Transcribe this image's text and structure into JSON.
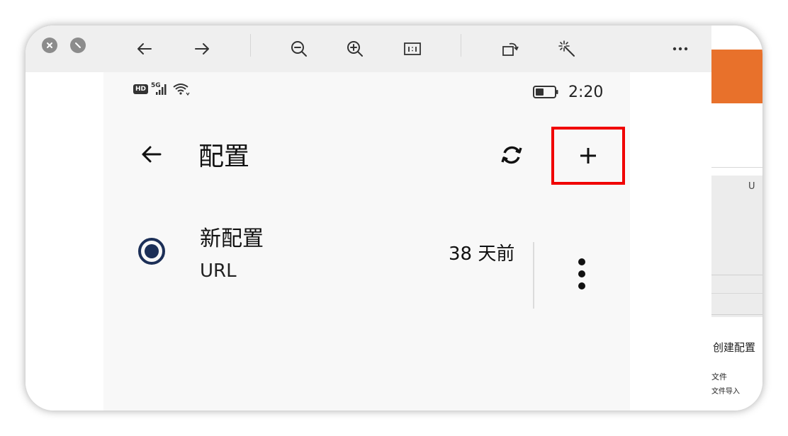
{
  "viewer_toolbar": {
    "close_label": "close",
    "minimize_label": "minimize",
    "items": [
      {
        "icon": "arrow-left-icon"
      },
      {
        "icon": "arrow-right-icon"
      },
      {
        "icon": "zoom-out-icon"
      },
      {
        "icon": "zoom-in-icon"
      },
      {
        "icon": "actual-size-icon"
      },
      {
        "icon": "rotate-icon"
      },
      {
        "icon": "magic-wand-icon"
      },
      {
        "icon": "more-horizontal-icon"
      }
    ]
  },
  "status_bar": {
    "hd": "HD",
    "network": "5G",
    "time": "2:20"
  },
  "app_bar": {
    "title": "配置"
  },
  "profile": {
    "name": "新配置",
    "type": "URL",
    "updated": "38 天前",
    "selected": true
  },
  "background_window": {
    "create_text": "创建配置",
    "file_text": "文件",
    "import_text": "文件导入",
    "ticks": "U"
  },
  "colors": {
    "accent": "#1c2f57",
    "highlight_border": "#f00000",
    "orange_bar": "#e8712b"
  }
}
